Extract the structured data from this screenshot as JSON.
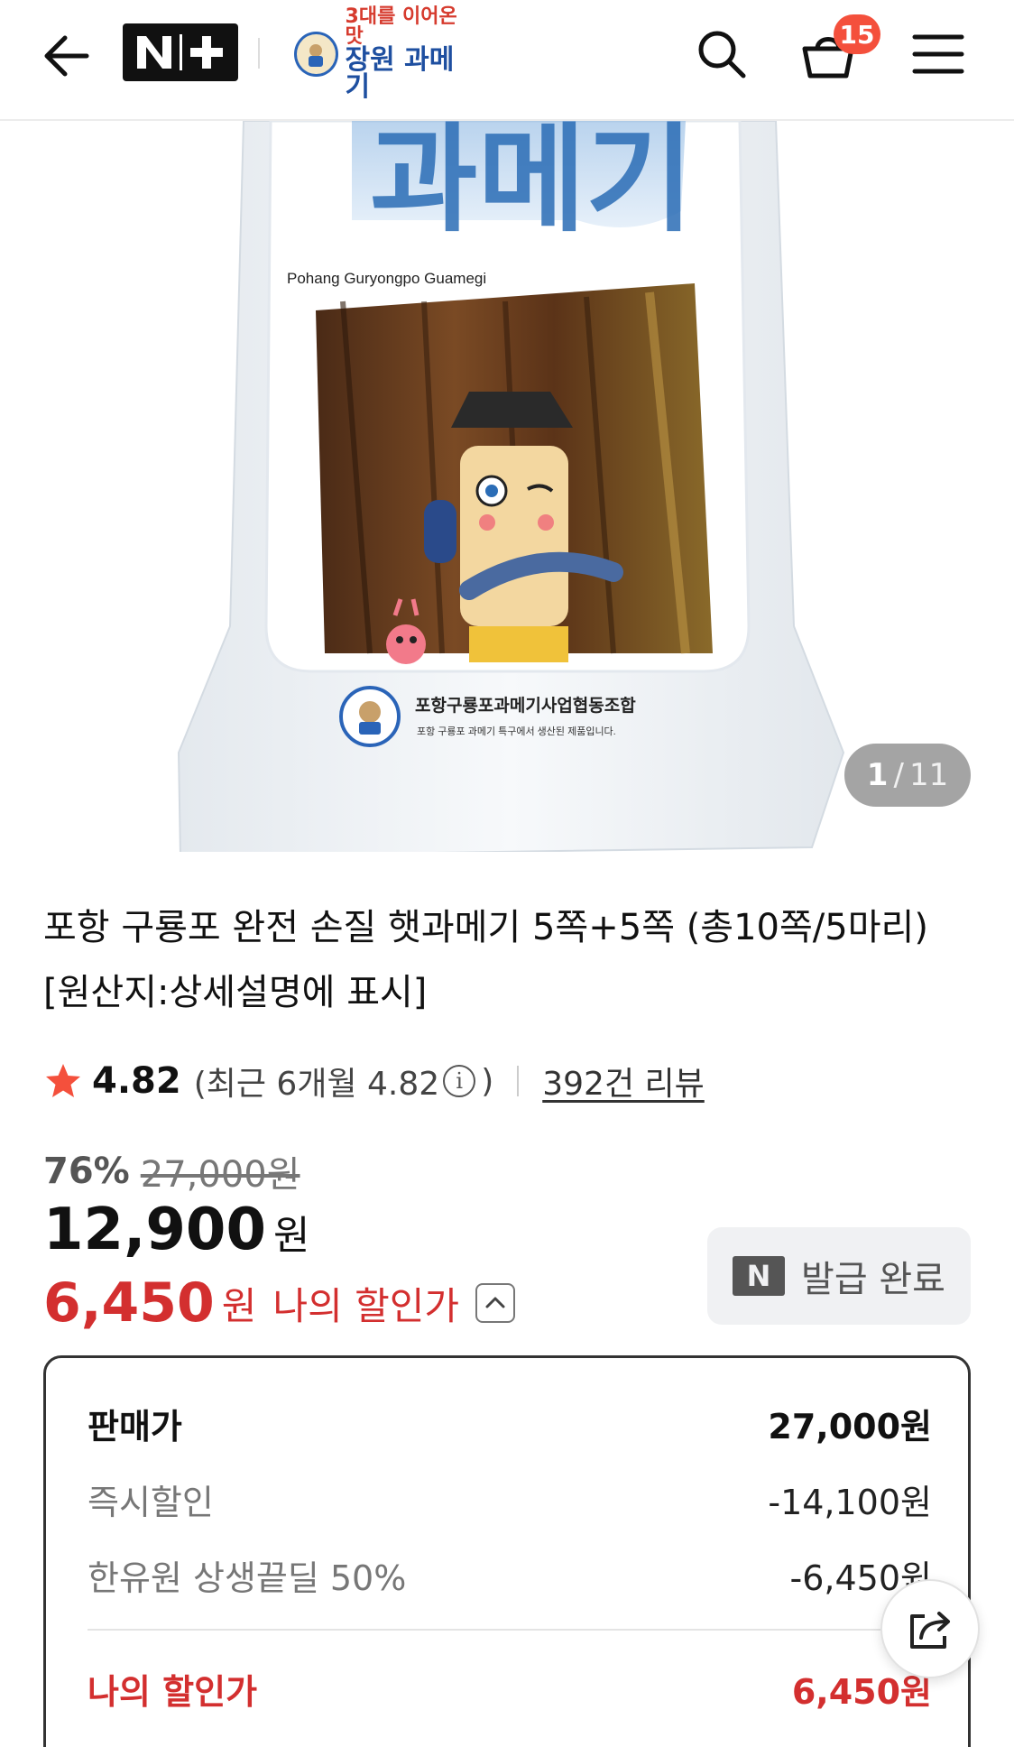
{
  "header": {
    "nplus_label": "N+",
    "store_logo_text_top": "3대를 이어온맛",
    "store_logo_text_main": "장원 과메기",
    "cart_count": "15"
  },
  "hero": {
    "package_title": "과메기",
    "package_subtitle": "Pohang Guryongpo Guamegi",
    "seal_line1": "포항구룡포과메기사업협동조합",
    "seal_line2": "포항 구룡포 과메기 특구에서 생산된 제품입니다.",
    "counter_current": "1",
    "counter_separator": "/",
    "counter_total": "11"
  },
  "product": {
    "title": "포항 구룡포 완전 손질 햇과메기 5쪽+5쪽 (총10쪽/5마리) [원산지:상세설명에 표시]",
    "rating": "4.82",
    "recent_rating": "(최근 6개월 4.82",
    "recent_close": ")",
    "review_link": "392건 리뷰",
    "discount_rate": "76%",
    "original_price": "27,000원",
    "sale_price": "12,900",
    "won": "원",
    "my_price": "6,450",
    "my_price_label": "나의 할인가",
    "coupon_button": "발급 완료"
  },
  "breakdown": {
    "rows": [
      {
        "label": "판매가",
        "value": "27,000원"
      },
      {
        "label": "즉시할인",
        "value": "-14,100원"
      },
      {
        "label": "한유원 상생끝딜 50%",
        "value": "-6,450원"
      },
      {
        "label": "나의 할인가",
        "value": "6,450원"
      }
    ]
  },
  "colors": {
    "accent_red": "#d32f2f",
    "badge_red": "#f4503c",
    "star": "#f4503c"
  }
}
